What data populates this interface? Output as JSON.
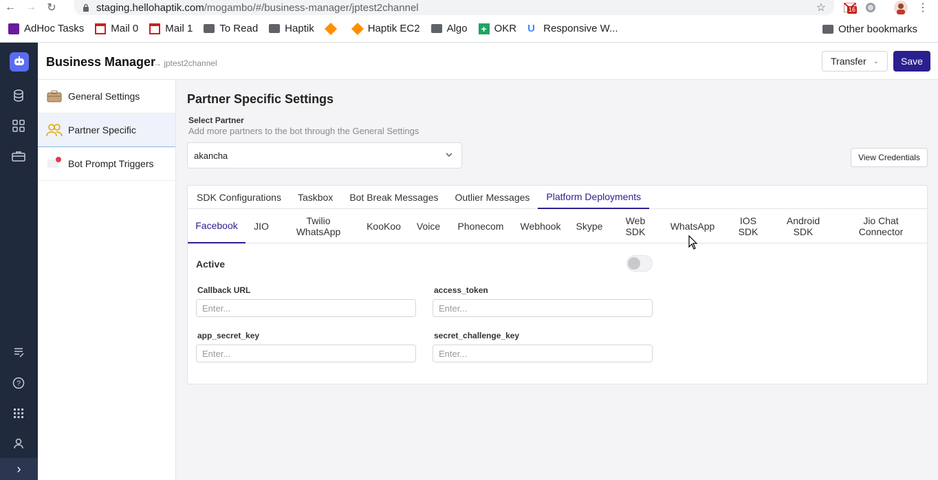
{
  "browser": {
    "url_host": "staging.hellohaptik.com",
    "url_path": "/mogambo/#/business-manager/jptest2channel",
    "gmail_badge": "16",
    "bookmarks": [
      {
        "label": "AdHoc Tasks",
        "icon": "list-icon",
        "color": "#6a1b9a"
      },
      {
        "label": "Mail 0",
        "icon": "gmail-icon",
        "color": "#c5221f"
      },
      {
        "label": "Mail 1",
        "icon": "gmail-icon",
        "color": "#c5221f"
      },
      {
        "label": "To Read",
        "icon": "folder-icon",
        "color": "#5f6368"
      },
      {
        "label": "Haptik",
        "icon": "folder-icon",
        "color": "#5f6368"
      },
      {
        "label": "",
        "icon": "cube-icon",
        "color": "#ff8f00"
      },
      {
        "label": "Haptik EC2",
        "icon": "cube-icon",
        "color": "#ff8f00"
      },
      {
        "label": "Algo",
        "icon": "folder-icon",
        "color": "#5f6368"
      },
      {
        "label": "OKR",
        "icon": "plus-square-icon",
        "color": "#1ea362"
      },
      {
        "label": "Responsive W...",
        "icon": "u-icon",
        "color": "#3d8bfd"
      }
    ],
    "other_bookmarks": "Other bookmarks"
  },
  "header": {
    "title": "Business Manager",
    "subtitle": "→ jptest2channel",
    "transfer_label": "Transfer",
    "save_label": "Save"
  },
  "sidebar": {
    "items": [
      {
        "label": "General Settings",
        "icon": "briefcase-icon"
      },
      {
        "label": "Partner Specific",
        "icon": "users-icon"
      },
      {
        "label": "Bot Prompt Triggers",
        "icon": "chat-alert-icon"
      }
    ]
  },
  "main": {
    "title": "Partner Specific Settings",
    "select_label": "Select Partner",
    "select_help": "Add more partners to the bot through the General Settings",
    "selected_partner": "akancha",
    "view_credentials_label": "View Credentials",
    "tabs": [
      "SDK Configurations",
      "Taskbox",
      "Bot Break Messages",
      "Outlier Messages",
      "Platform Deployments"
    ],
    "active_tab": "Platform Deployments",
    "platforms": [
      "Facebook",
      "JIO",
      "Twilio\nWhatsApp",
      "KooKoo",
      "Voice",
      "Phonecom",
      "Webhook",
      "Skype",
      "Web\nSDK",
      "WhatsApp",
      "IOS\nSDK",
      "Android\nSDK",
      "Jio Chat\nConnector"
    ],
    "active_platform": "Facebook",
    "active_label": "Active",
    "active_on": false,
    "fields": {
      "callback_url": {
        "label": "Callback URL",
        "placeholder": "Enter..."
      },
      "access_token": {
        "label": "access_token",
        "placeholder": "Enter..."
      },
      "app_secret_key": {
        "label": "app_secret_key",
        "placeholder": "Enter..."
      },
      "secret_challenge_key": {
        "label": "secret_challenge_key",
        "placeholder": "Enter..."
      }
    }
  },
  "colors": {
    "accent": "#2a1f8f",
    "rail": "#1f2a3c",
    "rail_logo": "#5b6cf0"
  }
}
